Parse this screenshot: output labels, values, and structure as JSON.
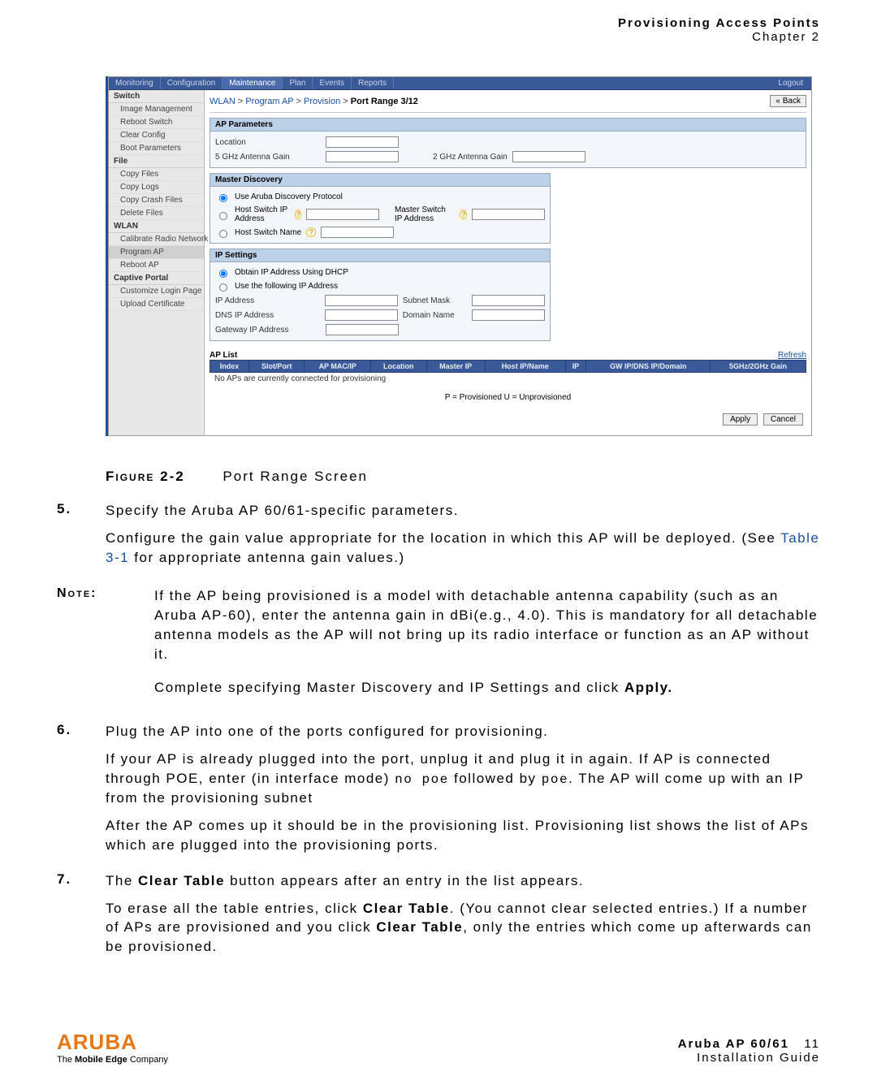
{
  "header": {
    "title": "Provisioning Access Points",
    "chapter": "Chapter 2"
  },
  "screenshot": {
    "topbar": {
      "tabs": [
        "Monitoring",
        "Configuration",
        "Maintenance",
        "Plan",
        "Events",
        "Reports"
      ],
      "logout": "Logout"
    },
    "sidebar": {
      "groups": [
        {
          "label": "Switch",
          "items": [
            "Image Management",
            "Reboot Switch",
            "Clear Config",
            "Boot Parameters"
          ]
        },
        {
          "label": "File",
          "items": [
            "Copy Files",
            "Copy Logs",
            "Copy Crash Files",
            "Delete Files"
          ]
        },
        {
          "label": "WLAN",
          "items": [
            "Calibrate Radio Network",
            "Program AP",
            "Reboot AP"
          ]
        },
        {
          "label": "Captive Portal",
          "items": [
            "Customize Login Page",
            "Upload Certificate"
          ]
        }
      ]
    },
    "crumbs": [
      "WLAN",
      "Program AP",
      "Provision",
      "Port Range 3/12"
    ],
    "back": "« Back",
    "sections": {
      "ap_params": {
        "title": "AP Parameters",
        "location": "Location",
        "g5": "5 GHz Antenna Gain",
        "g2": "2 GHz Antenna Gain"
      },
      "master": {
        "title": "Master Discovery",
        "use_adp": "Use Aruba Discovery Protocol",
        "host_ip": "Host Switch IP Address",
        "master_ip": "Master Switch IP Address",
        "host_name": "Host Switch Name"
      },
      "ip": {
        "title": "IP Settings",
        "dhcp": "Obtain IP Address Using DHCP",
        "following": "Use the following IP Address",
        "ipaddr": "IP Address",
        "subnet": "Subnet Mask",
        "dns": "DNS IP Address",
        "domain": "Domain Name",
        "gateway": "Gateway IP Address"
      }
    },
    "aplist": {
      "title": "AP List",
      "refresh": "Refresh",
      "headers": [
        "Index",
        "Slot/Port",
        "AP MAC/IP",
        "Location",
        "Master IP",
        "Host IP/Name",
        "IP",
        "GW IP/DNS IP/Domain",
        "5GHz/2GHz Gain"
      ],
      "empty": "No APs are currently connected for provisioning",
      "legend": "P = Provisioned U = Unprovisioned"
    },
    "actions": {
      "apply": "Apply",
      "cancel": "Cancel"
    }
  },
  "figure": {
    "label": "Figure 2-2",
    "caption": "Port Range Screen"
  },
  "steps": {
    "s5": {
      "num": "5.",
      "lead": "Specify the Aruba AP 60/61-specific parameters.",
      "p1a": "Configure the gain value appropriate for the location in which this AP will be deployed. (See ",
      "link": "Table 3-1",
      "p1b": " for appropriate antenna gain values.)"
    },
    "note": {
      "label": "Note:",
      "body": "If the AP being provisioned is a model with detachable antenna capability (such as an Aruba AP-60), enter the antenna gain in dBi(e.g., 4.0). This is mandatory for all detachable antenna models as the AP will not bring up its radio interface or function as an AP without it.",
      "after_a": "Complete specifying Master Discovery and IP Settings and click ",
      "after_b": "Apply."
    },
    "s6": {
      "num": "6.",
      "lead": "Plug the AP into one of the ports configured for provisioning.",
      "p1a": "If your AP is already plugged into the port, unplug it and plug it in again. If AP is connected through POE, enter (in interface mode) ",
      "code1": "no poe",
      "p1b": " followed by ",
      "code2": "poe",
      "p1c": ". The AP will come up with an IP from the provisioning subnet",
      "p2": "After the AP comes up it should be in the provisioning list. Provisioning list shows the list of APs which are plugged into the provisioning ports."
    },
    "s7": {
      "num": "7.",
      "lead_a": "The ",
      "lead_bold": "Clear Table",
      "lead_b": " button appears after an entry in the list appears.",
      "p1a": "To erase all the table entries, click ",
      "p1bold1": "Clear Table",
      "p1b": ". (You cannot clear selected entries.) If a number of APs are provisioned and you click ",
      "p1bold2": "Clear Table",
      "p1c": ", only the entries which come up afterwards can be provisioned."
    }
  },
  "footer": {
    "logo": "ARUBA",
    "tag_a": "The ",
    "tag_b": "Mobile Edge",
    "tag_c": " Company",
    "product": "Aruba AP 60/61",
    "page": "11",
    "guide": "Installation Guide"
  }
}
